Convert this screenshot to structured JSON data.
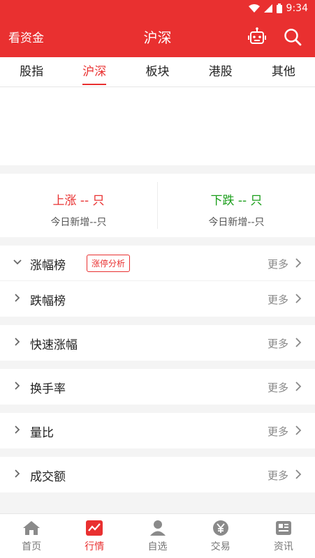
{
  "status": {
    "time": "9:34"
  },
  "header": {
    "left_text": "看资金",
    "title": "沪深"
  },
  "tabs": [
    {
      "label": "股指"
    },
    {
      "label": "沪深"
    },
    {
      "label": "板块"
    },
    {
      "label": "港股"
    },
    {
      "label": "其他"
    }
  ],
  "updown": {
    "up_main": "上涨 -- 只",
    "up_sub": "今日新增--只",
    "down_main": "下跌 -- 只",
    "down_sub": "今日新增--只"
  },
  "lists": [
    {
      "label": "涨幅榜",
      "badge": "涨停分析",
      "more": "更多"
    },
    {
      "label": "跌幅榜",
      "more": "更多"
    },
    {
      "label": "快速涨幅",
      "more": "更多"
    },
    {
      "label": "换手率",
      "more": "更多"
    },
    {
      "label": "量比",
      "more": "更多"
    },
    {
      "label": "成交额",
      "more": "更多"
    }
  ],
  "bottom_nav": [
    {
      "label": "首页",
      "icon": "home-icon"
    },
    {
      "label": "行情",
      "icon": "market-chart-icon"
    },
    {
      "label": "自选",
      "icon": "person-icon"
    },
    {
      "label": "交易",
      "icon": "yen-coin-icon"
    },
    {
      "label": "资讯",
      "icon": "news-icon"
    }
  ],
  "colors": {
    "brand": "#e93030",
    "up": "#e93030",
    "down": "#1a9e1a"
  }
}
